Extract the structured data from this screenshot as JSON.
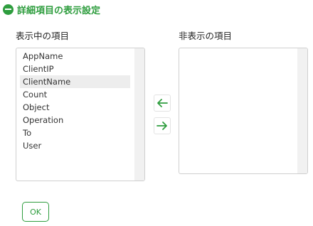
{
  "header": {
    "title": "詳細項目の表示設定",
    "icon": "minus-circle-icon",
    "accent": "#2e9d3e"
  },
  "shown_list": {
    "label": "表示中の項目",
    "items": [
      "AppName",
      "ClientIP",
      "ClientName",
      "Count",
      "Object",
      "Operation",
      "To",
      "User"
    ],
    "selected": "ClientName"
  },
  "hidden_list": {
    "label": "非表示の項目",
    "items": []
  },
  "buttons": {
    "move_left_icon": "arrow-left-icon",
    "move_right_icon": "arrow-right-icon",
    "ok_label": "OK"
  }
}
